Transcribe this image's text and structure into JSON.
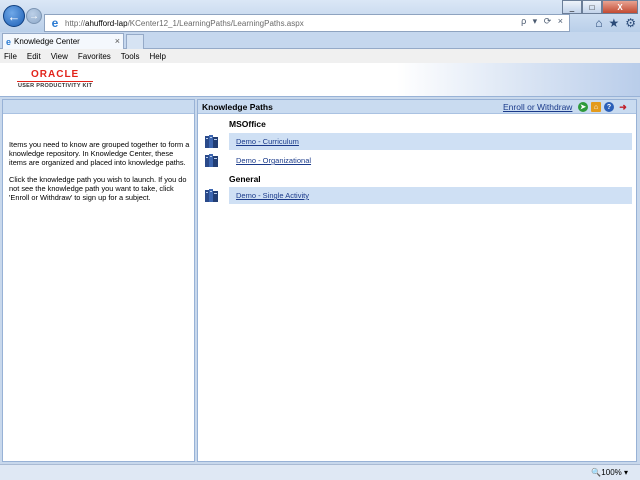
{
  "browser": {
    "url_prefix": "http://",
    "url_host": "ahufford-lap",
    "url_path": "/KCenter12_1/LearningPaths/LearningPaths.aspx",
    "address_tools": "ρ ▾ ⟳ ×",
    "tab_title": "Knowledge Center",
    "tab_close": "×",
    "menu": [
      "File",
      "Edit",
      "View",
      "Favorites",
      "Tools",
      "Help"
    ],
    "zoom": "🔍100% ▾",
    "window_controls": [
      "_",
      "□",
      "X"
    ],
    "toolbar_icons": [
      "home-icon",
      "favorites-star-icon",
      "settings-gear-icon"
    ]
  },
  "header": {
    "brand": "ORACLE",
    "product": "USER PRODUCTIVITY KIT"
  },
  "left_pane": {
    "intro_1": "Items you need to know are grouped together to form a knowledge repository. In Knowledge Center, these items are organized and placed into knowledge paths.",
    "intro_2": "Click the knowledge path you wish to launch. If you do not see the knowledge path you want to take, click 'Enroll or Withdraw' to sign up for a subject."
  },
  "right_pane": {
    "title": "Knowledge Paths",
    "enroll_label": "Enroll or Withdraw",
    "groups": [
      {
        "name": "MSOffice",
        "paths": [
          "Demo - Curriculum",
          "Demo - Organizational"
        ]
      },
      {
        "name": "General",
        "paths": [
          "Demo - Single Activity"
        ]
      }
    ]
  },
  "colors": {
    "panel_header": "#c9dbf0",
    "row_highlight": "#cfe0f4",
    "link": "#1a3a8a",
    "oracle_red": "#e2231a"
  }
}
